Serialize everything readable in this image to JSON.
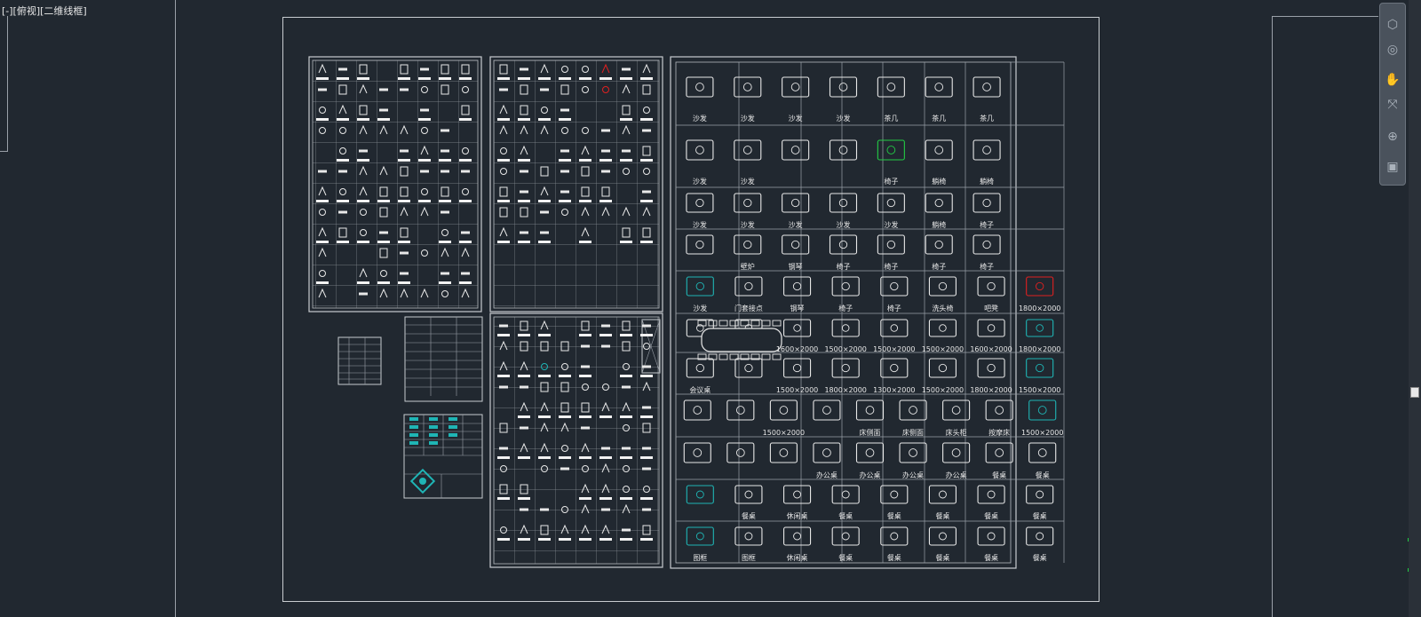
{
  "viewport": {
    "label": "[-][俯视][二维线框]"
  },
  "symbols_grid": {
    "rows": [
      [
        "沙发",
        "沙发",
        "沙发",
        "沙发",
        "茶几",
        "茶几",
        "茶几"
      ],
      [
        "沙发",
        "沙发",
        "",
        "",
        "椅子",
        "躺椅",
        "躺椅"
      ],
      [
        "沙发",
        "沙发",
        "沙发",
        "沙发",
        "沙发",
        "躺椅",
        "椅子"
      ],
      [
        "",
        "壁炉",
        "钢琴",
        "椅子",
        "椅子",
        "椅子",
        "椅子"
      ],
      [
        "沙发",
        "门套接点",
        "钢琴",
        "椅子",
        "椅子",
        "洗头椅",
        "吧凳",
        "1800×2000"
      ],
      [
        "",
        "",
        "1600×2000",
        "1500×2000",
        "1500×2000",
        "1500×2000",
        "1600×2000",
        "1800×2000"
      ],
      [
        "会议桌",
        "",
        "1500×2000",
        "1800×2000",
        "1300×2000",
        "1500×2000",
        "1800×2000",
        "1500×2000"
      ],
      [
        "",
        "",
        "1500×2000",
        "",
        "床侧面",
        "床侧面",
        "床头柜",
        "按摩床",
        "1500×2000"
      ],
      [
        "",
        "",
        "",
        "办公桌",
        "办公桌",
        "办公桌",
        "办公桌",
        "餐桌",
        "餐桌"
      ],
      [
        "",
        "餐桌",
        "休闲桌",
        "餐桌",
        "餐桌",
        "餐桌",
        "餐桌",
        "餐桌"
      ],
      [
        "图框",
        "图框",
        "休闲桌",
        "餐桌",
        "餐桌",
        "餐桌",
        "餐桌",
        "餐桌"
      ]
    ]
  },
  "nav_bar": {
    "icons": [
      "cube-icon",
      "steering-wheel-icon",
      "pan-hand-icon",
      "zoom-icon",
      "orbit-icon",
      "showmotion-icon"
    ]
  },
  "colors": {
    "background": "#212830",
    "line": "#c8ccd0",
    "accent_cyan": "#1fb5b5",
    "accent_red": "#e02020",
    "accent_green": "#22cc44"
  }
}
